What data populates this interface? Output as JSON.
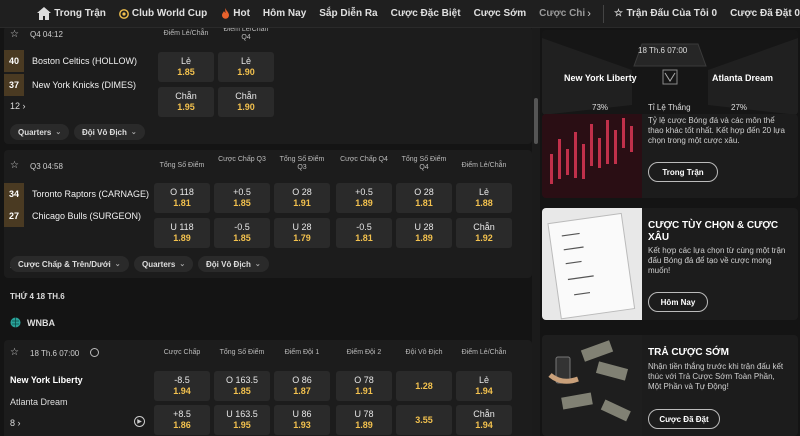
{
  "nav": {
    "items": [
      {
        "label": "Trong Trận"
      },
      {
        "label": "Club World Cup",
        "icon": "club-world-cup-icon"
      },
      {
        "label": "Hot",
        "icon": "fire-icon"
      },
      {
        "label": "Hôm Nay"
      },
      {
        "label": "Sắp Diễn Ra"
      },
      {
        "label": "Cược Đặc Biệt"
      },
      {
        "label": "Cược Sớm"
      },
      {
        "label": "Cược Chi"
      }
    ],
    "my_matches": "Trận Đấu Của Tôi 0",
    "bets_placed": "Cược Đã Đặt 0"
  },
  "game1": {
    "period": "Q4 04:12",
    "col_header": "Điểm Lẻ/Chẵn Q4",
    "col_header_left": "Điểm Lẻ/Chẵn",
    "team1": {
      "score": "40",
      "name": "Boston Celtics (HOLLOW)"
    },
    "team2": {
      "score": "37",
      "name": "New York Knicks (DIMES)"
    },
    "odds": [
      {
        "label": "Lẻ",
        "value": "1.85"
      },
      {
        "label": "Lẻ",
        "value": "1.90"
      },
      {
        "label": "Chẵn",
        "value": "1.95"
      },
      {
        "label": "Chẵn",
        "value": "1.90"
      }
    ],
    "more": "12",
    "chips": [
      "Quarters",
      "Đội Vô Địch"
    ]
  },
  "game2": {
    "period": "Q3 04:58",
    "col_headers": [
      "Tổng Số Điểm",
      "Cược Chấp Q3",
      "Tổng Số Điểm Q3",
      "Cược Chấp Q4",
      "Tổng Số Điểm Q4",
      "Điểm Lẻ/Chẵn"
    ],
    "team1": {
      "score": "34",
      "name": "Toronto Raptors (CARNAGE)"
    },
    "team2": {
      "score": "27",
      "name": "Chicago Bulls (SURGEON)"
    },
    "row1": [
      {
        "label": "O 118",
        "value": "1.81"
      },
      {
        "label": "+0.5",
        "value": "1.85"
      },
      {
        "label": "O 28",
        "value": "1.91"
      },
      {
        "label": "+0.5",
        "value": "1.89"
      },
      {
        "label": "O 28",
        "value": "1.81"
      },
      {
        "label": "Lẻ",
        "value": "1.88"
      }
    ],
    "row2": [
      {
        "label": "U 118",
        "value": "1.89"
      },
      {
        "label": "-0.5",
        "value": "1.85"
      },
      {
        "label": "U 28",
        "value": "1.79"
      },
      {
        "label": "-0.5",
        "value": "1.81"
      },
      {
        "label": "U 28",
        "value": "1.89"
      },
      {
        "label": "Chẵn",
        "value": "1.92"
      }
    ],
    "more": "19",
    "chips": [
      "Cược Chấp & Trên/Dưới",
      "Quarters",
      "Đội Vô Địch"
    ]
  },
  "date_header": "THỨ 4 18 TH.6",
  "league": "WNBA",
  "game3": {
    "time": "18 Th.6 07:00",
    "col_headers": [
      "Cược Chấp",
      "Tổng Số Điểm",
      "Điểm Đội 1",
      "Điểm Đội 2",
      "Đội Vô Địch",
      "Điểm Lẻ/Chẵn"
    ],
    "team1": "New York Liberty",
    "team2": "Atlanta Dream",
    "row1": [
      {
        "label": "-8.5",
        "value": "1.94"
      },
      {
        "label": "O 163.5",
        "value": "1.85"
      },
      {
        "label": "O 86",
        "value": "1.87"
      },
      {
        "label": "O 78",
        "value": "1.91"
      },
      {
        "label": "",
        "value": "1.28"
      },
      {
        "label": "Lẻ",
        "value": "1.94"
      }
    ],
    "row2": [
      {
        "label": "+8.5",
        "value": "1.86"
      },
      {
        "label": "U 163.5",
        "value": "1.95"
      },
      {
        "label": "U 86",
        "value": "1.93"
      },
      {
        "label": "U 78",
        "value": "1.89"
      },
      {
        "label": "",
        "value": "3.55"
      },
      {
        "label": "Chẵn",
        "value": "1.94"
      }
    ],
    "more": "8"
  },
  "featured": {
    "time": "18 Th.6 07:00",
    "team1": "New York Liberty",
    "team2": "Atlanta Dream",
    "pct1": "73%",
    "label": "Tỉ Lệ Thắng",
    "pct2": "27%"
  },
  "promos": [
    {
      "text": "Tỷ lệ cược Bóng đá và các môn thể thao khác tốt nhất. Kết hợp đến 20 lựa chọn trong một cược xâu.",
      "button": "Trong Trận"
    },
    {
      "title": "CƯỢC TÙY CHỌN & CƯỢC XÂU",
      "text": "Kết hợp các lựa chọn từ cùng một trận đấu Bóng đá để tạo về cược mong muốn!",
      "button": "Hôm Nay"
    },
    {
      "title": "TRẢ CƯỢC SỚM",
      "text": "Nhận tiền thắng trước khi trận đấu kết thúc với Trả Cược Sớm Toàn Phần, Một Phần và Tự Động!",
      "button": "Cược Đã Đặt"
    }
  ],
  "colors": {
    "accent": "#f2c14e",
    "bg": "#141414",
    "card": "#1c1c1c",
    "odd": "#2a2a2a",
    "live": "#8a6a3a"
  }
}
